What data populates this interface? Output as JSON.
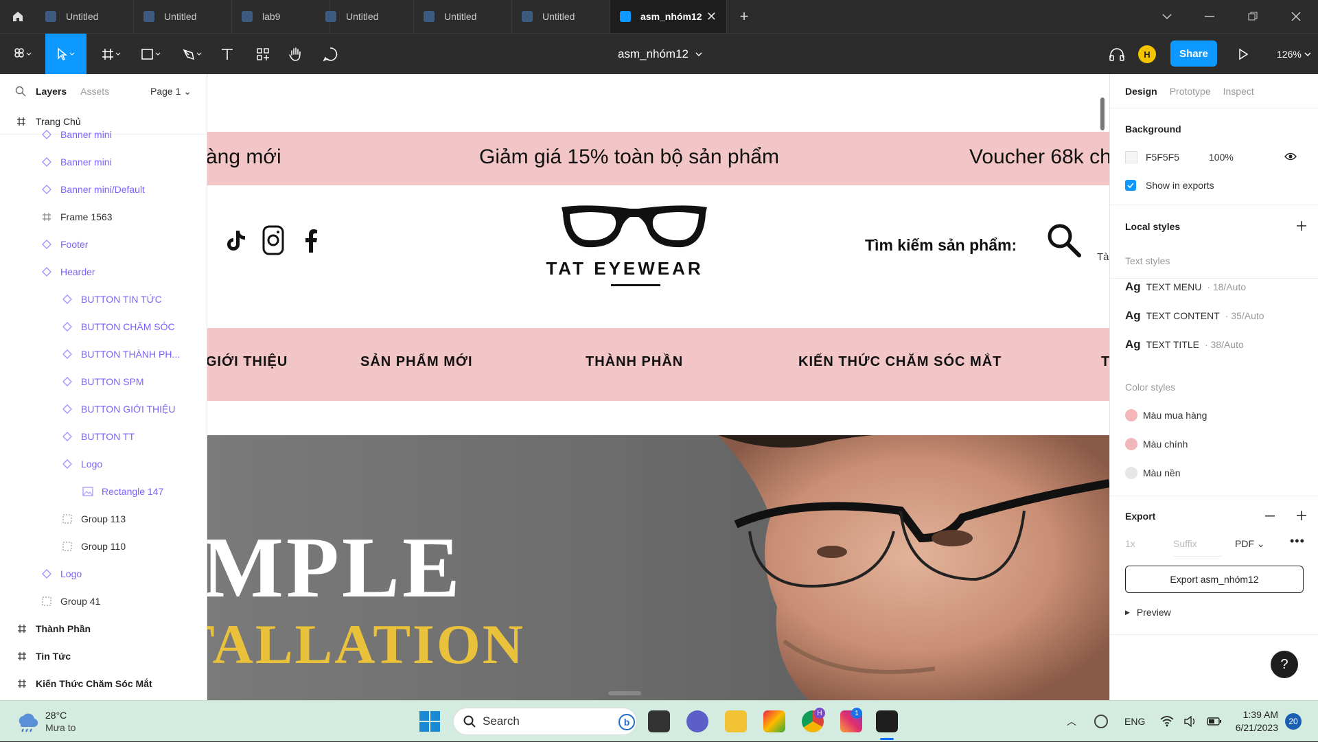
{
  "tabs": [
    {
      "label": "Untitled"
    },
    {
      "label": "Untitled"
    },
    {
      "label": "lab9"
    },
    {
      "label": "Untitled"
    },
    {
      "label": "Untitled"
    },
    {
      "label": "Untitled"
    },
    {
      "label": "asm_nhóm12"
    }
  ],
  "toolbar": {
    "file_title": "asm_nhóm12",
    "share_label": "Share",
    "avatar_initial": "H",
    "zoom": "126%"
  },
  "left_panel": {
    "tab_layers": "Layers",
    "tab_assets": "Assets",
    "page": "Page 1",
    "page_name": "Trang Chủ",
    "layers": [
      {
        "label": "Banner mini",
        "type": "component"
      },
      {
        "label": "Banner mini",
        "type": "component"
      },
      {
        "label": "Banner mini/Default",
        "type": "component"
      },
      {
        "label": "Frame 1563",
        "type": "frame"
      },
      {
        "label": "Footer",
        "type": "component"
      },
      {
        "label": "Hearder",
        "type": "component"
      },
      {
        "label": "BUTTON TIN TỨC",
        "type": "component"
      },
      {
        "label": "BUTTON CHĂM SÓC",
        "type": "component"
      },
      {
        "label": "BUTTON THÀNH PH...",
        "type": "component"
      },
      {
        "label": "BUTTON SPM",
        "type": "component"
      },
      {
        "label": "BUTTON GIỚI THIỆU",
        "type": "component"
      },
      {
        "label": "BUTTON TT",
        "type": "component"
      },
      {
        "label": "Logo",
        "type": "component"
      },
      {
        "label": "Rectangle 147",
        "type": "image"
      },
      {
        "label": "Group 113",
        "type": "group"
      },
      {
        "label": "Group 110",
        "type": "group"
      },
      {
        "label": "Logo",
        "type": "component"
      },
      {
        "label": "Group 41",
        "type": "group"
      }
    ],
    "pages": [
      {
        "label": "Thành Phần"
      },
      {
        "label": "Tin Tức"
      },
      {
        "label": "Kiến Thức Chăm Sóc Mắt"
      }
    ]
  },
  "canvas": {
    "promo": [
      "àng mới",
      "Giảm  giá 15% toàn bộ sản phẩm",
      "Voucher 68k ch"
    ],
    "brand": "TAT EYEWEAR",
    "search_label": "Tìm kiếm sản  phẩm:",
    "search_cut": "Tà",
    "nav": [
      "GIỚI THIỆU",
      "SẢN PHẨM MỚI",
      "THÀNH PHẦN",
      "KIẾN THỨC CHĂM SÓC MẮT",
      "T"
    ],
    "hero_line1": "MPLE",
    "hero_line2": "TALLATION"
  },
  "right_panel": {
    "tabs": [
      "Design",
      "Prototype",
      "Inspect"
    ],
    "background_title": "Background",
    "bg_hex": "F5F5F5",
    "bg_opacity": "100%",
    "show_exports": "Show in exports",
    "local_styles": "Local styles",
    "text_styles": "Text styles",
    "text_style_items": [
      {
        "name": "TEXT MENU",
        "meta": "· 18/Auto"
      },
      {
        "name": "TEXT CONTENT",
        "meta": "· 35/Auto"
      },
      {
        "name": "TEXT TITLE",
        "meta": "· 38/Auto"
      }
    ],
    "color_styles": "Color styles",
    "color_style_items": [
      {
        "name": "Màu mua hàng",
        "color": "#f4b6b8"
      },
      {
        "name": "Màu chính",
        "color": "#f0b8ba"
      },
      {
        "name": "Màu nền",
        "color": "#e6e6e6"
      }
    ],
    "export_title": "Export",
    "export_scale": "1x",
    "export_suffix": "Suffix",
    "export_format": "PDF",
    "export_button": "Export asm_nhóm12",
    "preview": "Preview",
    "help": "?"
  },
  "taskbar": {
    "temp": "28°C",
    "weather": "Mưa to",
    "search": "Search",
    "lang": "ENG",
    "time": "1:39 AM",
    "date": "6/21/2023",
    "notif": "20",
    "chrome_badge": "H",
    "insta_badge": "1"
  },
  "colors": {
    "accent": "#0d99ff",
    "pink": "#f2c5c6",
    "purple": "#7b61ff"
  }
}
